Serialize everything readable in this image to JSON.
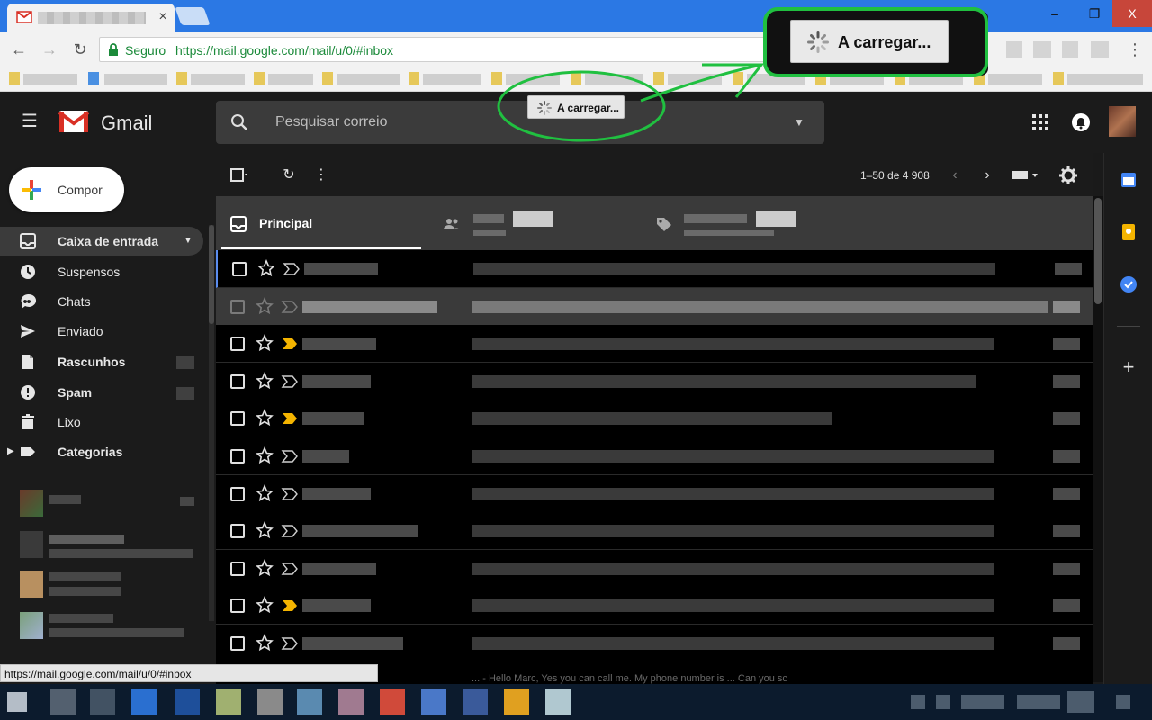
{
  "browser": {
    "tab_close": "×",
    "window": {
      "minimize": "–",
      "maximize": "❐",
      "close": "X"
    },
    "address": {
      "secure_label": "Seguro",
      "url": "https://mail.google.com/mail/u/0/#inbox"
    },
    "status_url": "https://mail.google.com/mail/u/0/#inbox",
    "menu_dots": "⋮"
  },
  "gmail": {
    "brand": "Gmail",
    "search": {
      "placeholder": "Pesquisar correio"
    },
    "loading_label": "A carregar...",
    "compose_label": "Compor",
    "nav": [
      {
        "label": "Caixa de entrada",
        "icon": "inbox-icon",
        "active": true
      },
      {
        "label": "Suspensos",
        "icon": "clock-icon"
      },
      {
        "label": "Chats",
        "icon": "chat-icon"
      },
      {
        "label": "Enviado",
        "icon": "send-icon"
      },
      {
        "label": "Rascunhos",
        "icon": "draft-icon"
      },
      {
        "label": "Spam",
        "icon": "spam-icon"
      },
      {
        "label": "Lixo",
        "icon": "trash-icon"
      },
      {
        "label": "Categorias",
        "icon": "label-icon"
      }
    ],
    "toolbar": {
      "pager": "1–50 de 4 908"
    },
    "tabs": {
      "principal": "Principal"
    },
    "bottom_snippet": "... - Hello Marc, Yes you can call me. My phone number is ... Can you sc"
  },
  "colors": {
    "gmail_red": "#d93025",
    "accent_blue": "#2b78e4",
    "important_yellow": "#f4b400"
  }
}
